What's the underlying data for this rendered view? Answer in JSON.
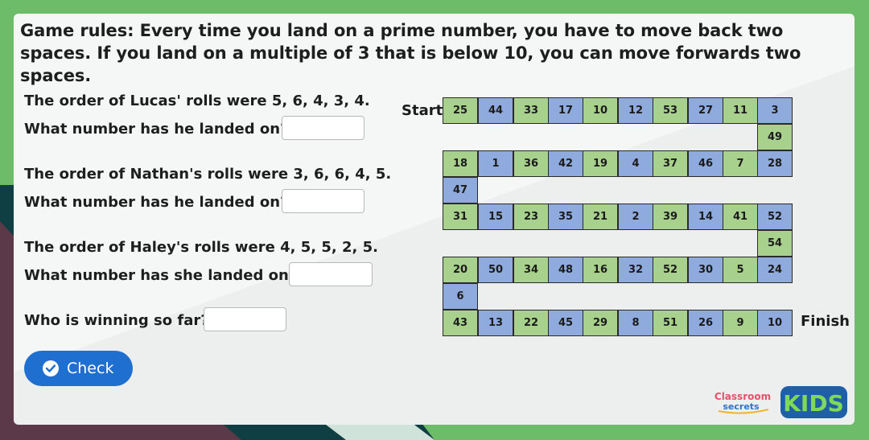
{
  "rules": "Game rules: Every time you land on a prime number, you have to move back two spaces. If you land on a multiple of 3 that is below 10, you can move forwards two spaces.",
  "questions": [
    {
      "statement": "The order of Lucas' rolls were 5, 6, 4, 3, 4.",
      "prompt": "What number has he landed on?",
      "answer": ""
    },
    {
      "statement": "The order of Nathan's rolls were 3, 6, 6, 4, 5.",
      "prompt": "What number has he landed on?",
      "answer": ""
    },
    {
      "statement": "The order of Haley's rolls were 4, 5, 5, 2, 5.",
      "prompt": "What number has she landed on?",
      "answer": ""
    }
  ],
  "winner_prompt": "Who is winning so far?",
  "winner_answer": "",
  "check_label": "Check",
  "board": {
    "start_label": "Start",
    "finish_label": "Finish",
    "rows": [
      [
        "25",
        "44",
        "33",
        "17",
        "10",
        "12",
        "53",
        "27",
        "11",
        "3"
      ],
      [
        "49"
      ],
      [
        "18",
        "1",
        "36",
        "42",
        "19",
        "4",
        "37",
        "46",
        "7",
        "28"
      ],
      [
        "47"
      ],
      [
        "31",
        "15",
        "23",
        "35",
        "21",
        "2",
        "39",
        "14",
        "41",
        "52"
      ],
      [
        "54"
      ],
      [
        "20",
        "50",
        "34",
        "48",
        "16",
        "32",
        "52",
        "30",
        "5",
        "24"
      ],
      [
        "6"
      ],
      [
        "43",
        "13",
        "22",
        "45",
        "29",
        "8",
        "51",
        "26",
        "9",
        "10"
      ]
    ]
  },
  "logo": {
    "line1": "Classroom",
    "line2": "secrets",
    "badge": "KIDS"
  },
  "colors": {
    "green_cell": "#a9d18e",
    "blue_cell": "#8faadc",
    "button": "#1f6fd1",
    "background": "#6cbc6a"
  }
}
